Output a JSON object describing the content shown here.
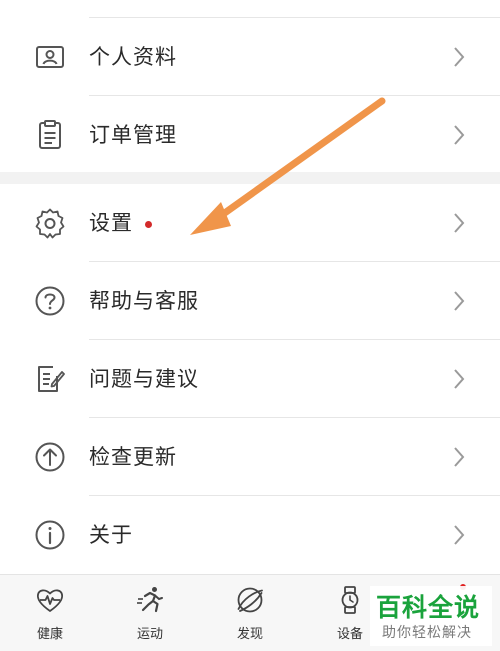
{
  "colors": {
    "accent_arrow": "#f0954a",
    "notify_dot": "#d32a2a",
    "watermark_green": "#1aa33c",
    "text_primary": "#2a2a2a",
    "icon_gray": "#555555"
  },
  "menu": {
    "items": [
      {
        "label": "个人资料",
        "icon": "profile-card-icon"
      },
      {
        "label": "订单管理",
        "icon": "clipboard-icon"
      },
      {
        "label": "设置",
        "icon": "gear-icon",
        "has_dot": true
      },
      {
        "label": "帮助与客服",
        "icon": "help-circle-icon"
      },
      {
        "label": "问题与建议",
        "icon": "feedback-edit-icon"
      },
      {
        "label": "检查更新",
        "icon": "arrow-up-circle-icon"
      },
      {
        "label": "关于",
        "icon": "info-circle-icon"
      }
    ]
  },
  "tabbar": {
    "tabs": [
      {
        "label": "健康",
        "icon": "heart-pulse-icon"
      },
      {
        "label": "运动",
        "icon": "running-icon"
      },
      {
        "label": "发现",
        "icon": "planet-icon"
      },
      {
        "label": "设备",
        "icon": "watch-icon"
      }
    ]
  },
  "watermark": {
    "title": "百科全说",
    "subtitle": "助你轻松解决"
  }
}
